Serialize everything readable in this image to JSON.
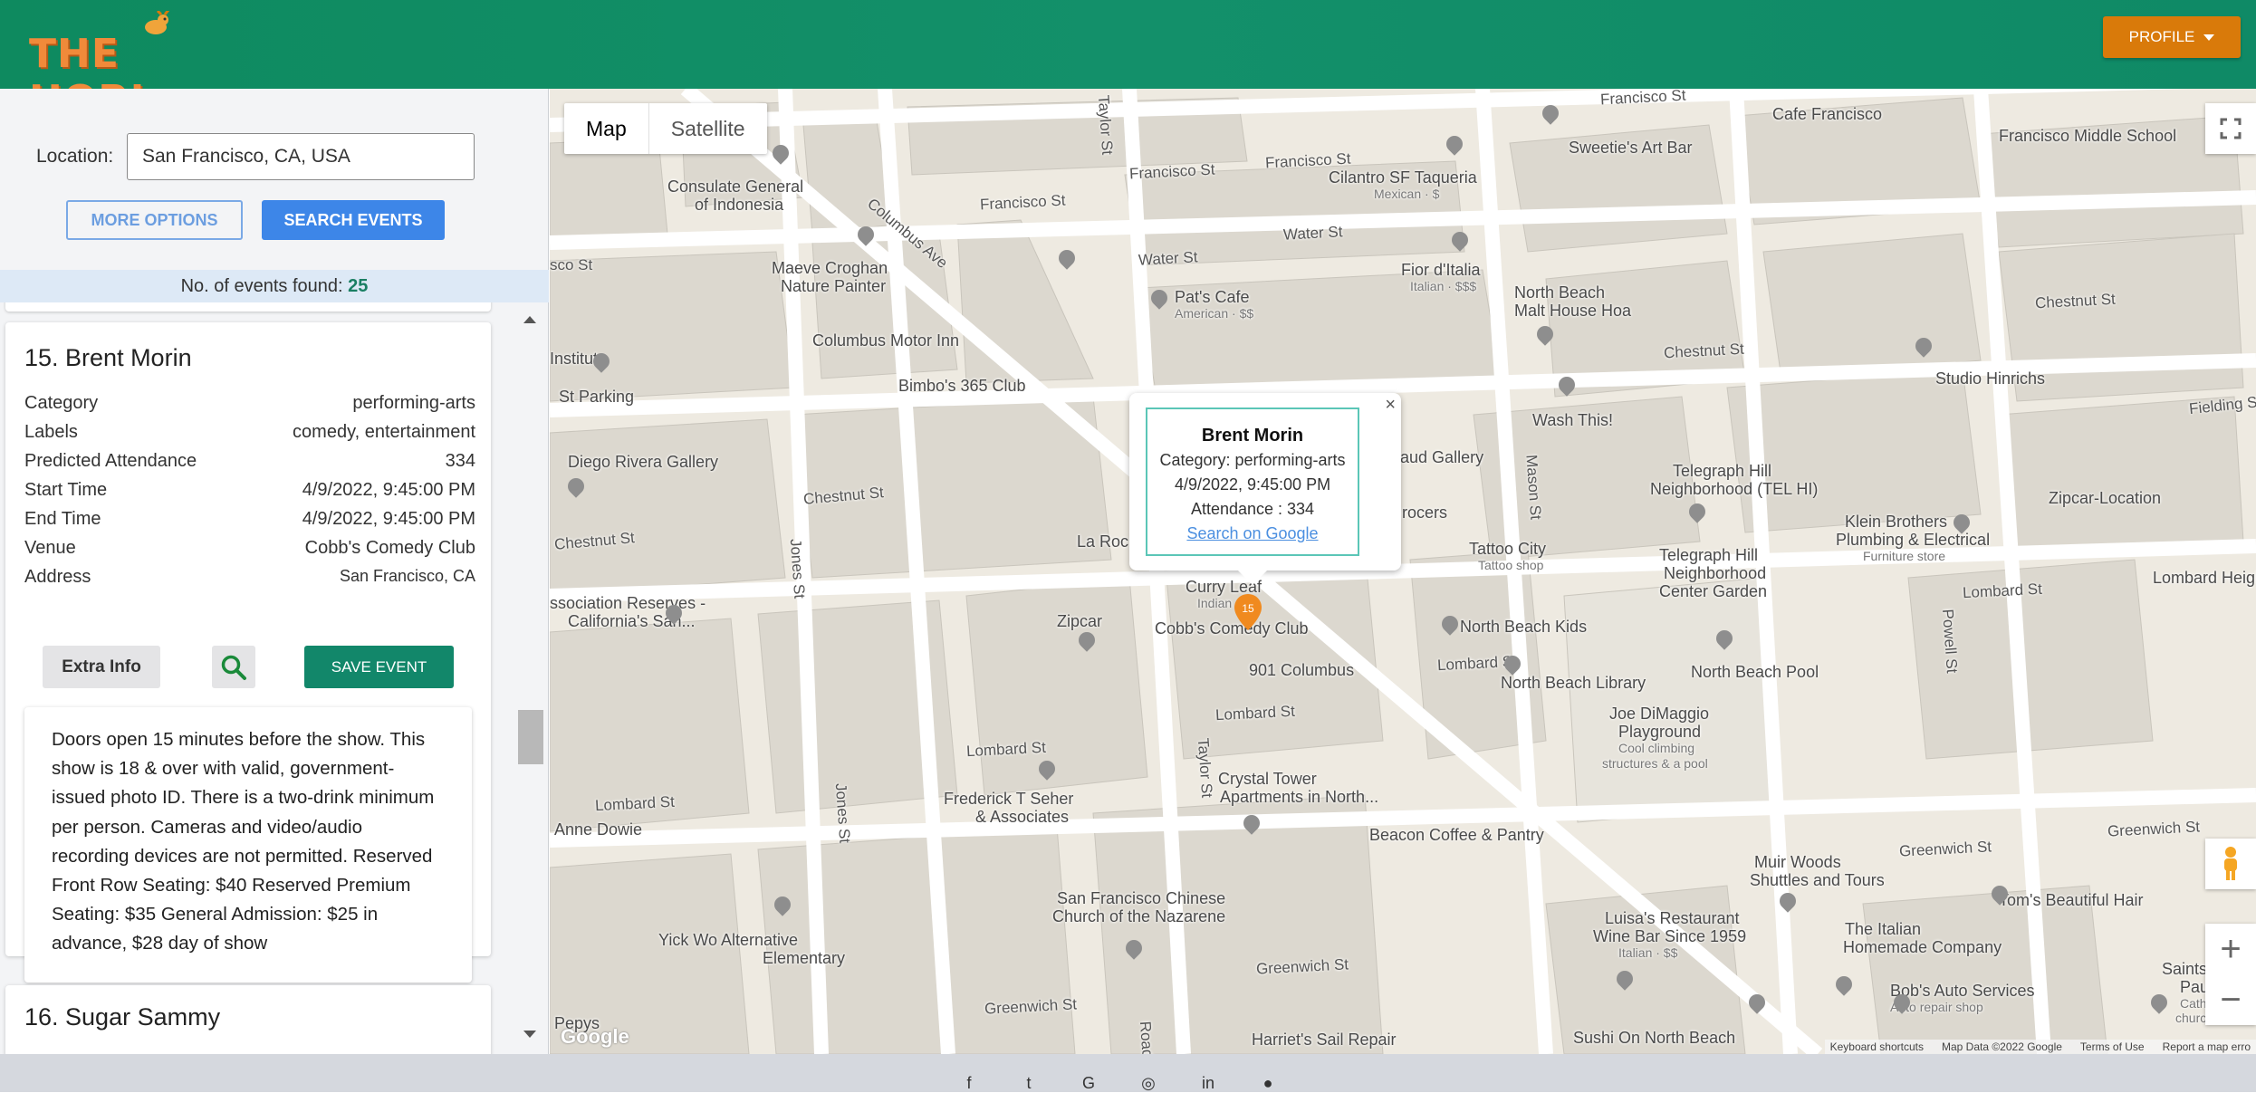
{
  "header": {
    "logo_text": "THE HOP!",
    "profile_label": "PROFILE"
  },
  "search": {
    "location_label": "Location:",
    "location_value": "San Francisco, CA, USA",
    "more_options_label": "MORE OPTIONS",
    "search_label": "SEARCH EVENTS",
    "count_label": "No. of events found:",
    "count_value": "25"
  },
  "event": {
    "title": "15. Brent Morin",
    "rows": [
      {
        "label": "Category",
        "value": "performing-arts"
      },
      {
        "label": "Labels",
        "value": "comedy, entertainment"
      },
      {
        "label": "Predicted Attendance",
        "value": "334"
      },
      {
        "label": "Start Time",
        "value": "4/9/2022, 9:45:00 PM"
      },
      {
        "label": "End Time",
        "value": "4/9/2022, 9:45:00 PM"
      },
      {
        "label": "Venue",
        "value": "Cobb's Comedy Club"
      },
      {
        "label": "Address",
        "value": "San Francisco, CA"
      }
    ],
    "extra_info_label": "Extra Info",
    "save_label": "SAVE EVENT",
    "description": "Doors open 15 minutes before the show. This show is 18 & over with valid, government-issued photo ID. There is a two-drink minimum per person. Cameras and video/audio recording devices are not permitted. Reserved Front Row Seating: $40 Reserved Premium Seating: $35 General Admission: $25 in advance, $28 day of show"
  },
  "next_event": {
    "title": "16. Sugar Sammy"
  },
  "map": {
    "type_map": "Map",
    "type_satellite": "Satellite",
    "infowindow": {
      "title": "Brent Morin",
      "category": "Category: performing-arts",
      "time": "4/9/2022, 9:45:00 PM",
      "attendance": "Attendance : 334",
      "link": "Search on Google"
    },
    "marker_label": "15",
    "google": "Google",
    "attribution": [
      "Keyboard shortcuts",
      "Map Data ©2022 Google",
      "Terms of Use",
      "Report a map erro"
    ],
    "places": {
      "cafe_francisco": "Cafe Francisco",
      "francisco_middle": "Francisco Middle School",
      "sweeties": "Sweetie's Art Bar",
      "cilantro": "Cilantro SF Taqueria",
      "cilantro_sub": "Mexican · $",
      "consulate": "Consulate General",
      "consulate2": "of Indonesia",
      "maeve": "Maeve Croghan",
      "maeve2": "Nature Painter",
      "pats": "Pat's Cafe",
      "pats_sub": "American · $$",
      "fior": "Fior d'Italia",
      "fior_sub": "Italian · $$$",
      "northbeach_malt": "North Beach",
      "northbeach_malt2": "Malt House Hoa",
      "columbus_inn": "Columbus Motor Inn",
      "bimbos": "Bimbo's 365 Club",
      "institute": "Institute",
      "stparking": "St Parking",
      "diego": "Diego Rivera Gallery",
      "washthis": "Wash This!",
      "studio": "Studio Hinrichs",
      "gallery": "iebaud Gallery",
      "grocers": "n Grocers",
      "telegraph": "Telegraph Hill",
      "telegraph2": "Neighborhood (TEL HI)",
      "klein": "Klein Brothers",
      "klein2": "Plumbing & Electrical",
      "klein_sub": "Furniture store",
      "zipcar_loc": "Zipcar-Location",
      "tattoo": "Tattoo City",
      "tattoo_sub": "Tattoo shop",
      "telegraph_center": "Telegraph Hill",
      "telegraph_center2": "Neighborhood",
      "telegraph_center3": "Center Garden",
      "larocca": "La Roc",
      "curryleaf": "Curry Leaf",
      "curryleaf_sub": "Indian",
      "zipcar": "Zipcar",
      "cobbs": "Cobb's Comedy Club",
      "columbus901": "901 Columbus",
      "nbkids": "North Beach Kids",
      "nbpool": "North Beach Pool",
      "nblibrary": "North Beach Library",
      "joedimaggio": "Joe DiMaggio",
      "joedimaggio2": "Playground",
      "joedimaggio_sub": "Cool climbing",
      "joedimaggio_sub2": "structures & a pool",
      "association": "ssociation Reserves -",
      "association2": "California's San...",
      "frederick": "Frederick T Seher",
      "frederick2": "& Associates",
      "crystal": "Crystal Tower",
      "crystal2": "Apartments in North...",
      "beacon": "Beacon Coffee & Pantry",
      "annedowie": "Anne Dowie",
      "sfchinese": "San Francisco Chinese",
      "sfchinese2": "Church of the Nazarene",
      "yickwo": "Yick Wo Alternative",
      "yickwo2": "Elementary",
      "muirwoods": "Muir Woods",
      "muirwoods2": "Shuttles and Tours",
      "toms": "Tom's Beautiful Hair",
      "luisas": "Luisa's Restaurant",
      "luisas2": "Wine Bar Since 1959",
      "luisas_sub": "Italian · $$",
      "italianhome": "The Italian",
      "italianhome2": "Homemade Company",
      "bobs": "Bob's Auto Services",
      "bobs_sub": "Auto repair shop",
      "saintspeter": "Saints Peter",
      "saintspeter2": "Paul Ch",
      "saintspeter_sub": "Catholic",
      "saintspeter_sub2": "church with",
      "harriets": "Harriet's Sail Repair",
      "sushi": "Sushi On North Beach",
      "lombardheights": "Lombard Heights M",
      "pepys": "Pepys"
    },
    "streets": {
      "francisco1": "Francisco St",
      "francisco2": "Francisco St",
      "francisco3": "Francisco St",
      "francisco4": "Francisco St",
      "columbus": "Columbus Ave",
      "water1": "Water St",
      "water2": "Water St",
      "chestnut1": "Chestnut St",
      "chestnut2": "Chestnut St",
      "chestnut3": "Chestnut St",
      "chestnut4": "Chestnut St",
      "lombard1": "Lombard St",
      "lombard2": "Lombard St",
      "lombard3": "Lombard St",
      "lombard4": "Lombard St",
      "lombard5": "Lombard St",
      "greenwich1": "Greenwich St",
      "greenwich2": "Greenwich St",
      "greenwich3": "Greenwich St",
      "greenwich4": "Greenwich St",
      "taylor1": "Taylor St",
      "taylor2": "Taylor St",
      "jones1": "Jones St",
      "jones2": "Jones St",
      "mason": "Mason St",
      "powell": "Powell St",
      "fielding": "Fielding St",
      "sco": "sco St",
      "road": "Road"
    }
  },
  "footer": {
    "icons": [
      "f",
      "t",
      "G",
      "◎",
      "in",
      "●"
    ]
  }
}
